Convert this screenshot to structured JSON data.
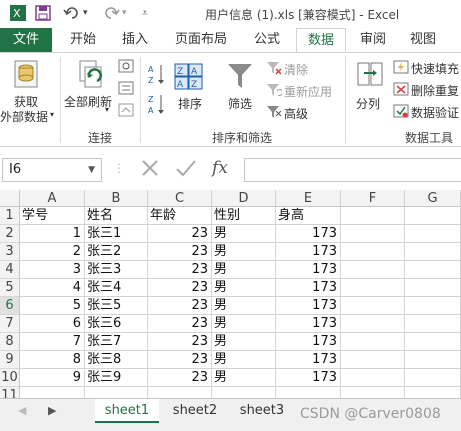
{
  "title_bar": {
    "save_icon": "save-icon",
    "undo_icon": "undo-icon",
    "redo_icon": "redo-icon",
    "customize_icon": "customize-icon",
    "title": "用户信息 (1).xls  [兼容模式] - Excel"
  },
  "tabs": {
    "file": "文件",
    "home": "开始",
    "insert": "插入",
    "page_layout": "页面布局",
    "formulas": "公式",
    "data": "数据",
    "review": "审阅",
    "view": "视图"
  },
  "ribbon": {
    "get_external_data": "获取\n外部数据",
    "get_external_data_line1": "获取",
    "get_external_data_line2": "外部数据",
    "refresh_all": "全部刷新",
    "connections_group": "连接",
    "sort": "排序",
    "filter": "筛选",
    "clear": "清除",
    "reapply": "重新应用",
    "advanced": "高级",
    "sort_filter_group": "排序和筛选",
    "text_to_columns": "分列",
    "flash_fill": "快速填充",
    "remove_duplicates": "删除重复",
    "data_validation": "数据验证",
    "data_tools_group": "数据工具",
    "sort_az": "A→Z",
    "sort_za": "Z→A"
  },
  "formula_bar": {
    "name_box": "I6",
    "fx": "fx",
    "formula": ""
  },
  "columns": [
    "A",
    "B",
    "C",
    "D",
    "E",
    "F",
    "G"
  ],
  "rows": [
    "1",
    "2",
    "3",
    "4",
    "5",
    "6",
    "7",
    "8",
    "9",
    "10",
    "11"
  ],
  "selected_row": "6",
  "table": {
    "headers": [
      "学号",
      "姓名",
      "年龄",
      "性别",
      "身高"
    ],
    "records": [
      [
        "1",
        "张三1",
        "23",
        "男",
        "173"
      ],
      [
        "2",
        "张三2",
        "23",
        "男",
        "173"
      ],
      [
        "3",
        "张三3",
        "23",
        "男",
        "173"
      ],
      [
        "4",
        "张三4",
        "23",
        "男",
        "173"
      ],
      [
        "5",
        "张三5",
        "23",
        "男",
        "173"
      ],
      [
        "6",
        "张三6",
        "23",
        "男",
        "173"
      ],
      [
        "7",
        "张三7",
        "23",
        "男",
        "173"
      ],
      [
        "8",
        "张三8",
        "23",
        "男",
        "173"
      ],
      [
        "9",
        "张三9",
        "23",
        "男",
        "173"
      ]
    ]
  },
  "sheets": [
    "sheet1",
    "sheet2",
    "sheet3"
  ],
  "active_sheet": "sheet1",
  "watermark": "CSDN @Carver0808",
  "colors": {
    "accent": "#217346",
    "file_tab_bg": "#217346"
  }
}
